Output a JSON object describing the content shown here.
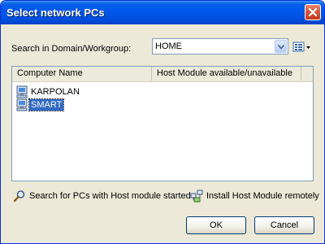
{
  "window": {
    "title": "Select network PCs"
  },
  "search": {
    "label": "Search in Domain/Workgroup:",
    "value": "HOME"
  },
  "list": {
    "columns": [
      "Computer Name",
      "Host Module available/unavailable"
    ],
    "rows": [
      {
        "name": "KARPOLAN",
        "icon": "computer-icon",
        "selected": false
      },
      {
        "name": "SMART",
        "icon": "computer-icon",
        "selected": true
      }
    ]
  },
  "actions": {
    "search_pcs": {
      "label": "Search for PCs with Host module started",
      "icon": "magnifier-icon"
    },
    "install": {
      "label": "Install Host Module remotely",
      "icon": "network-install-icon"
    }
  },
  "buttons": {
    "ok": "OK",
    "cancel": "Cancel"
  },
  "colors": {
    "title_bar": "#0054e3",
    "selection": "#316ac5",
    "dialog_bg": "#ece9d8"
  }
}
